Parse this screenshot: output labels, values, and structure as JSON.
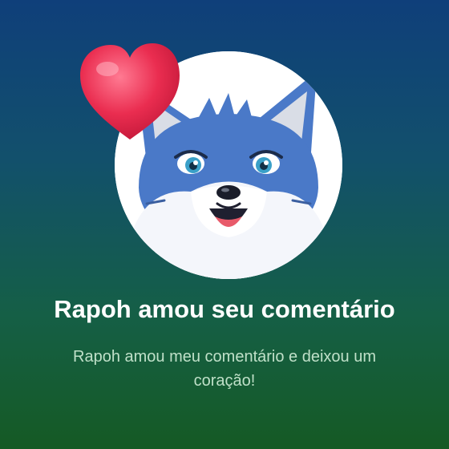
{
  "notification": {
    "title": "Rapoh amou seu comentário",
    "message": "Rapoh amou meu comentário e deixou um coração!",
    "avatar_icon": "fox-mascot-avatar",
    "reaction_icon": "heart-icon"
  },
  "colors": {
    "background_top": "#0f3f7a",
    "background_bottom": "#155a24",
    "title": "#ffffff",
    "message": "#bfe0c8",
    "heart": "#e8294a",
    "fox_blue": "#4a79c8"
  }
}
